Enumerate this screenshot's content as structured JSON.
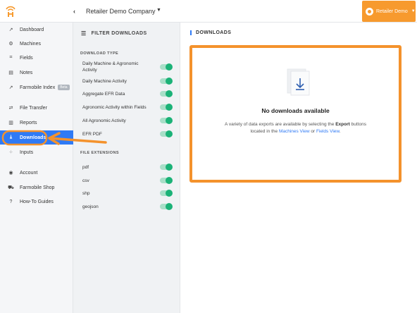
{
  "header": {
    "company": "Retailer Demo Company",
    "account_button": "Retailer Demo"
  },
  "sidebar": {
    "items": [
      {
        "label": "Dashboard",
        "icon": "trend-icon"
      },
      {
        "label": "Machines",
        "icon": "machine-icon"
      },
      {
        "label": "Fields",
        "icon": "fields-icon"
      },
      {
        "label": "Notes",
        "icon": "notes-icon"
      },
      {
        "label": "Farmobile Index",
        "icon": "index-icon",
        "badge": "Beta"
      },
      {
        "label": "File Transfer",
        "icon": "transfer-icon"
      },
      {
        "label": "Reports",
        "icon": "reports-icon"
      },
      {
        "label": "Downloads",
        "icon": "download-icon",
        "active": true
      },
      {
        "label": "Inputs",
        "icon": "inputs-icon"
      },
      {
        "label": "Account",
        "icon": "account-icon"
      },
      {
        "label": "Farmobile Shop",
        "icon": "shop-icon"
      },
      {
        "label": "How-To Guides",
        "icon": "help-icon"
      }
    ]
  },
  "filter": {
    "title": "FILTER DOWNLOADS",
    "download_type_title": "DOWNLOAD TYPE",
    "download_types": [
      "Daily Machine & Agronomic Activity",
      "Daily Machine Activity",
      "Aggregate EFR Data",
      "Agronomic Activity within Fields",
      "All Agronomic Activity",
      "EFR PDF"
    ],
    "extensions_title": "FILE EXTENSIONS",
    "extensions": [
      "pdf",
      "csv",
      "shp",
      "geojson"
    ]
  },
  "main": {
    "title": "DOWNLOADS",
    "empty_title": "No downloads available",
    "desc_1": "A variety of data exports are available by selecting the ",
    "desc_bold": "Export",
    "desc_2": " buttons located in the ",
    "machines_link": "Machines View",
    "desc_or": " or ",
    "fields_link": "Fields View",
    "desc_end": "."
  },
  "colors": {
    "accent": "#2f7af5",
    "brand_orange": "#f79a2e",
    "toggle_on": "#1bb277",
    "highlight": "#f4922c"
  }
}
